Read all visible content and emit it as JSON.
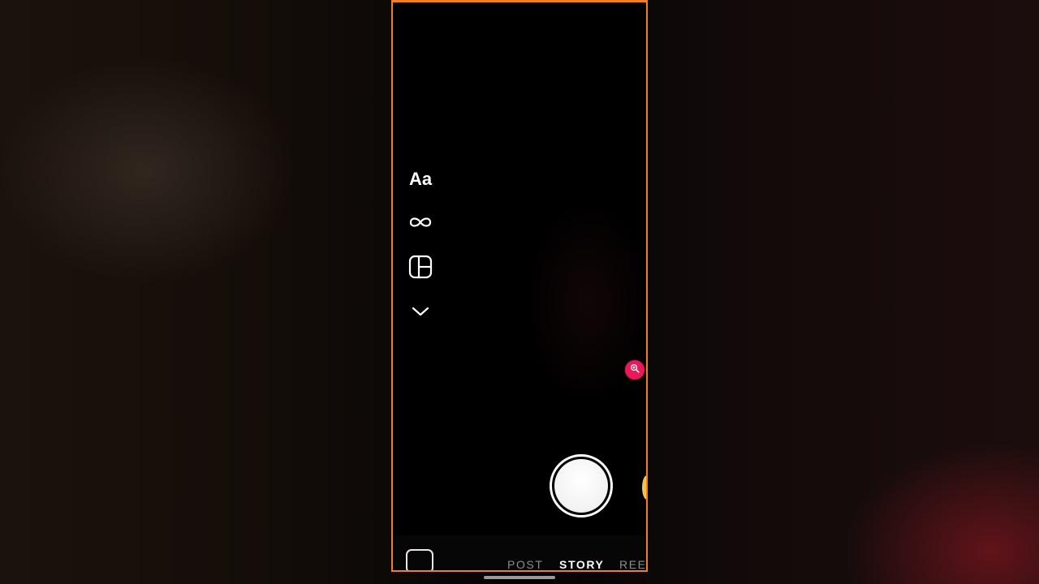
{
  "camera": {
    "tools": [
      {
        "name": "create-mode",
        "label": "Aa"
      },
      {
        "name": "boomerang",
        "icon": "infinity-icon"
      },
      {
        "name": "layout",
        "icon": "layout-icon"
      },
      {
        "name": "more-tools",
        "icon": "chevron-down-icon"
      }
    ],
    "zoom_icon": "magnifier-plus-icon",
    "shutter_icon": "shutter-button"
  },
  "modes": {
    "items": [
      "POST",
      "STORY",
      "REE"
    ],
    "active": "STORY"
  },
  "colors": {
    "frame": "#f07f22",
    "badge": "#e8185a",
    "effect": "#f3c44a"
  }
}
